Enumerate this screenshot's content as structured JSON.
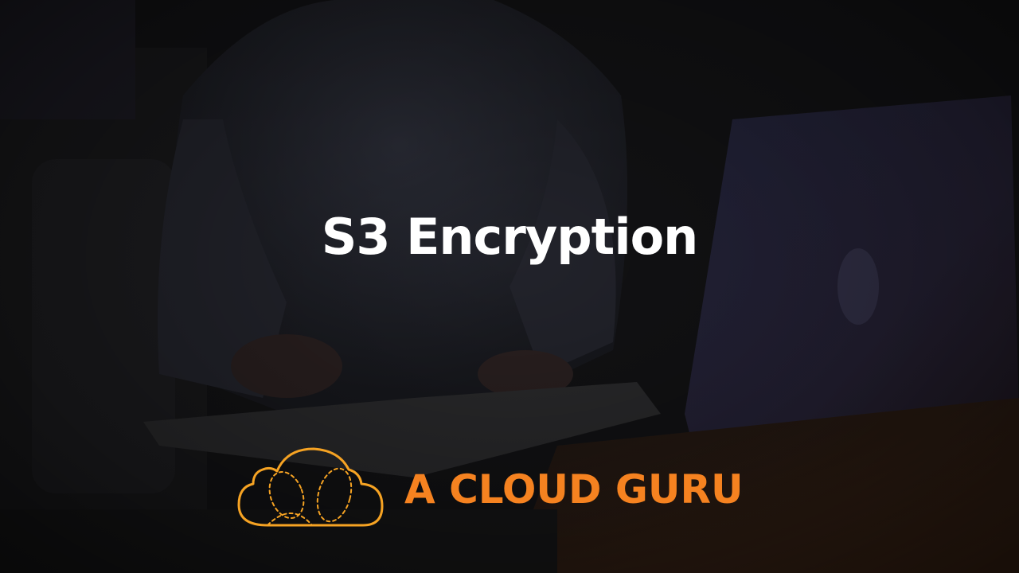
{
  "slide": {
    "title": "S3 Encryption"
  },
  "brand": {
    "name": "A CLOUD GURU",
    "logo_icon": "cloud-logo-icon",
    "color": "#f58220",
    "logo_color": "#f6a323"
  },
  "background": {
    "description_icon": "background-photo"
  }
}
